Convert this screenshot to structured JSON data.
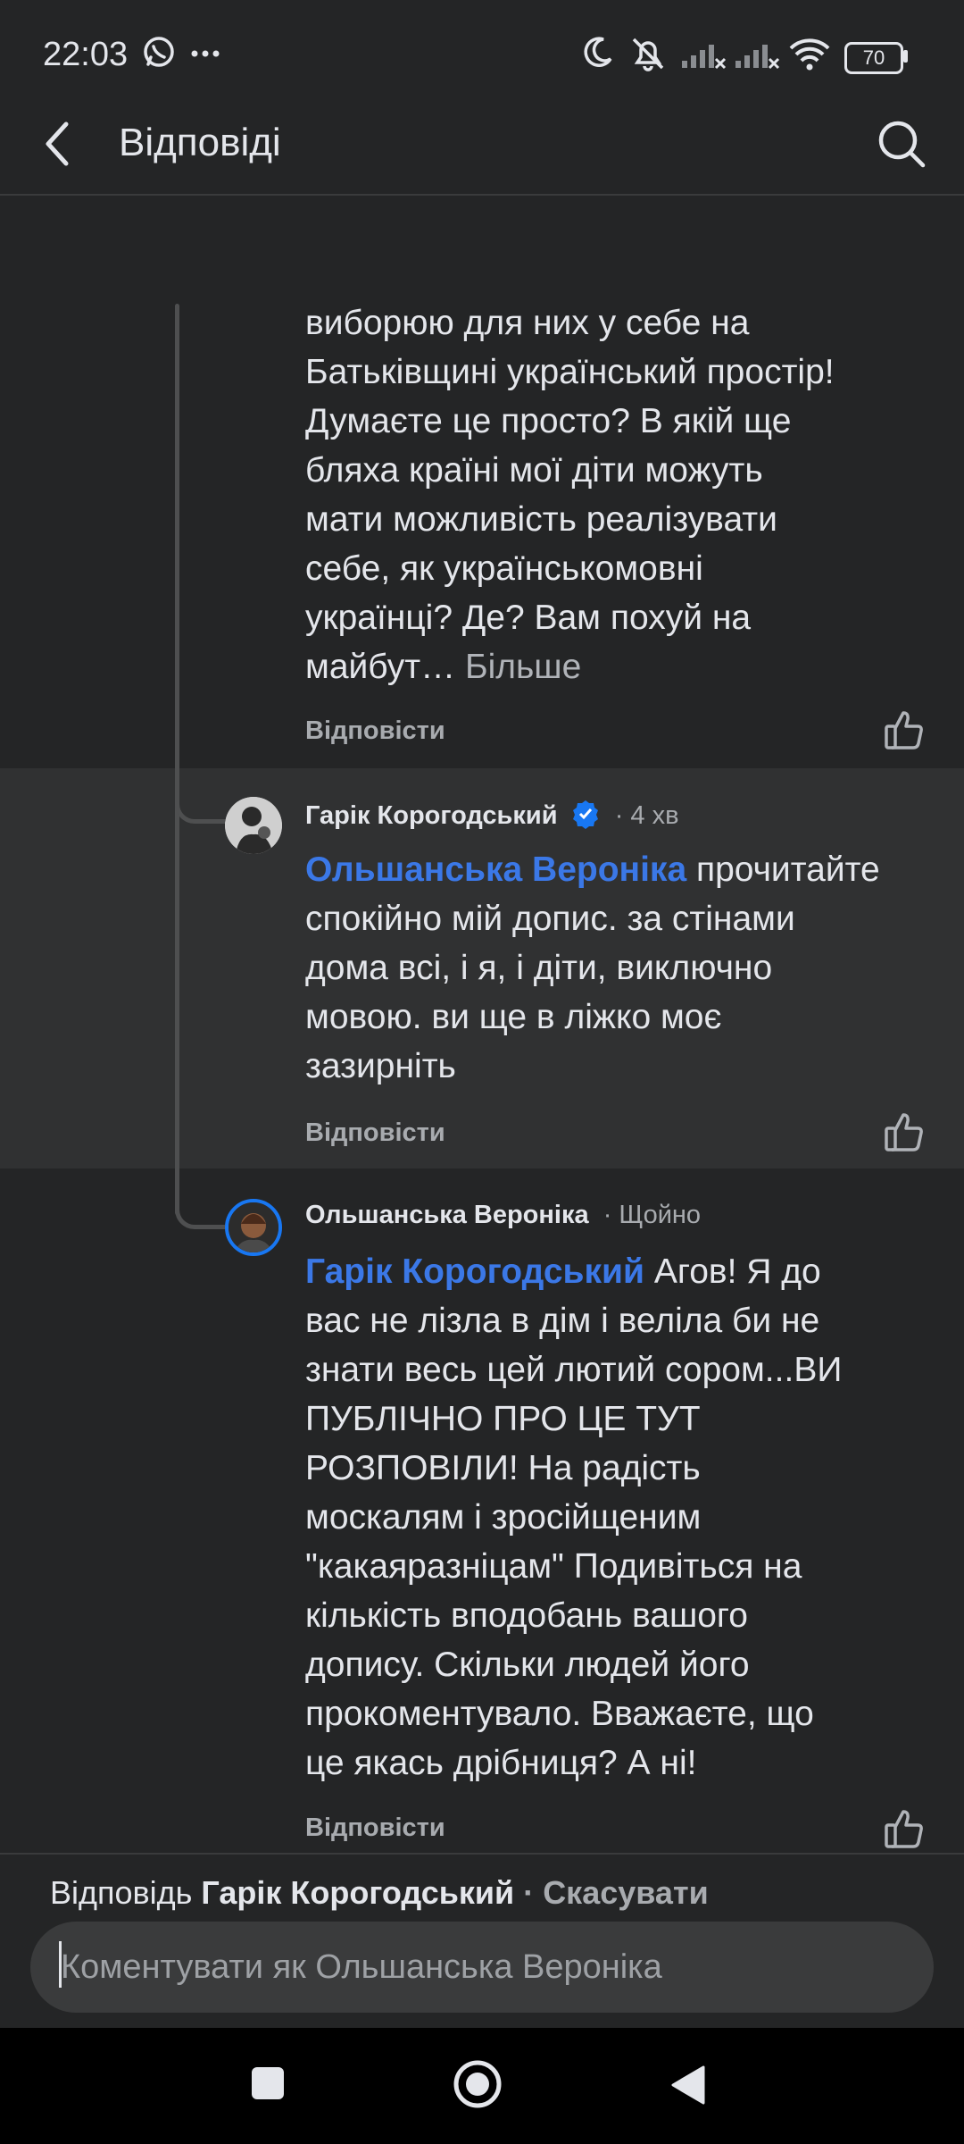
{
  "status_bar": {
    "time": "22:03",
    "icons": [
      "whatsapp-icon",
      "more-dots-icon",
      "moon-icon",
      "notifications-off-icon",
      "signal-off-icon",
      "signal-off-icon",
      "wifi-icon"
    ],
    "battery": "70"
  },
  "header": {
    "title": "Відповіді",
    "back_icon": "back-arrow-icon",
    "search_icon": "search-icon"
  },
  "comments": [
    {
      "text_lines": [
        "виборюю для них у себе на",
        "Батьківщині український простір!",
        "Думаєте це просто? В якій ще",
        "бляха країні мої діти можуть",
        "мати можливість реалізувати",
        "себе, як українськомовні",
        "українці? Де? Вам похуй на",
        "майбут… "
      ],
      "more_label": "Більше",
      "reply_label": "Відповісти"
    },
    {
      "author": "Гарік Корогодський",
      "time": "· 4 хв",
      "verified": true,
      "mention": "Ольшанська Вероніка",
      "text_lines": [
        " прочитайте",
        "спокійно мій допис. за стінами",
        "дома всі, і я, і діти, виключно",
        "мовою. ви ще в ліжко моє",
        "зазирніть"
      ],
      "reply_label": "Відповісти"
    },
    {
      "author": "Ольшанська Вероніка",
      "time": "· Щойно",
      "mention": "Гарік Корогодський",
      "text_lines": [
        " Агов! Я до",
        "вас не лізла в дім і веліла би не",
        "знати весь цей лютий сором...ВИ",
        "ПУБЛІЧНО ПРО ЦЕ ТУТ",
        "РОЗПОВІЛИ! На радість",
        "москалям і зросійщеним",
        "\"какаяразніцам\"  Подивіться на",
        "кількість вподобань вашого",
        "допису. Скільки людей його",
        "прокоментувало. Вважаєте, що",
        "це якась дрібниця? А ні!"
      ],
      "reply_label": "Відповісти"
    }
  ],
  "reply_bar": {
    "prefix": "Відповідь ",
    "name": "Гарік Корогодський",
    "separator": " · ",
    "cancel": "Скасувати",
    "placeholder": "Коментувати як Ольшанська Вероніка"
  },
  "colors": {
    "background": "#242526",
    "highlight": "#303132",
    "mention": "#3b78e7",
    "verified": "#1877f2"
  }
}
